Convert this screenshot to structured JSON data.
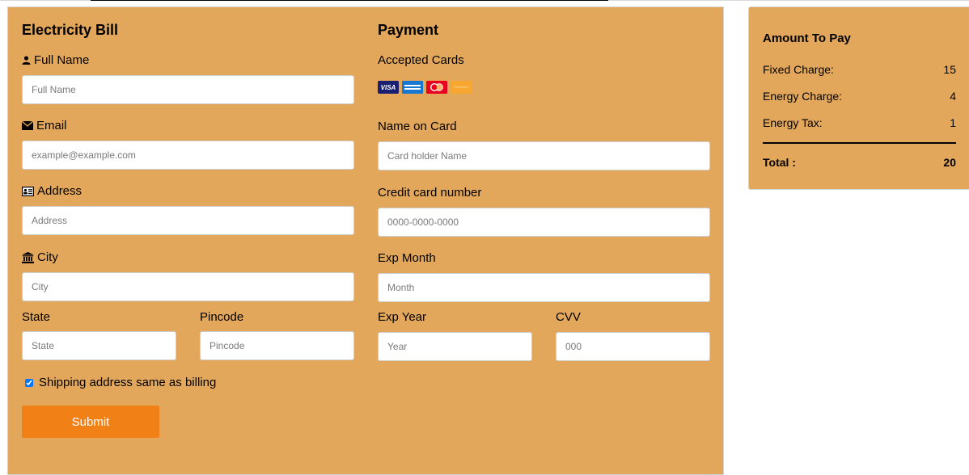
{
  "billing": {
    "title": "Electricity Bill",
    "full_name_label": "Full Name",
    "full_name_placeholder": "Full Name",
    "email_label": "Email",
    "email_placeholder": "example@example.com",
    "address_label": "Address",
    "address_placeholder": "Address",
    "city_label": "City",
    "city_placeholder": "City",
    "state_label": "State",
    "state_placeholder": "State",
    "pincode_label": "Pincode",
    "pincode_placeholder": "Pincode",
    "same_address_label": "Shipping address same as billing",
    "same_address_checked": true,
    "submit_label": "Submit"
  },
  "payment": {
    "title": "Payment",
    "accepted_cards_label": "Accepted Cards",
    "cards": [
      {
        "name": "VISA",
        "icon": "visa-icon"
      },
      {
        "name": "",
        "icon": "amex-icon"
      },
      {
        "name": "",
        "icon": "mastercard-icon"
      },
      {
        "name": "",
        "icon": "discover-icon"
      }
    ],
    "name_on_card_label": "Name on Card",
    "name_on_card_placeholder": "Card holder Name",
    "card_number_label": "Credit card number",
    "card_number_placeholder": "0000-0000-0000",
    "exp_month_label": "Exp Month",
    "exp_month_placeholder": "Month",
    "exp_year_label": "Exp Year",
    "exp_year_placeholder": "Year",
    "cvv_label": "CVV",
    "cvv_placeholder": "000"
  },
  "summary": {
    "title": "Amount To Pay",
    "rows": [
      {
        "label": "Fixed Charge:",
        "value": "15"
      },
      {
        "label": "Energy Charge:",
        "value": "4"
      },
      {
        "label": "Energy Tax:",
        "value": "1"
      }
    ],
    "total_label": "Total :",
    "total_value": "20"
  },
  "colors": {
    "panel_bg": "#e3a75c",
    "submit_bg": "#f18016"
  }
}
